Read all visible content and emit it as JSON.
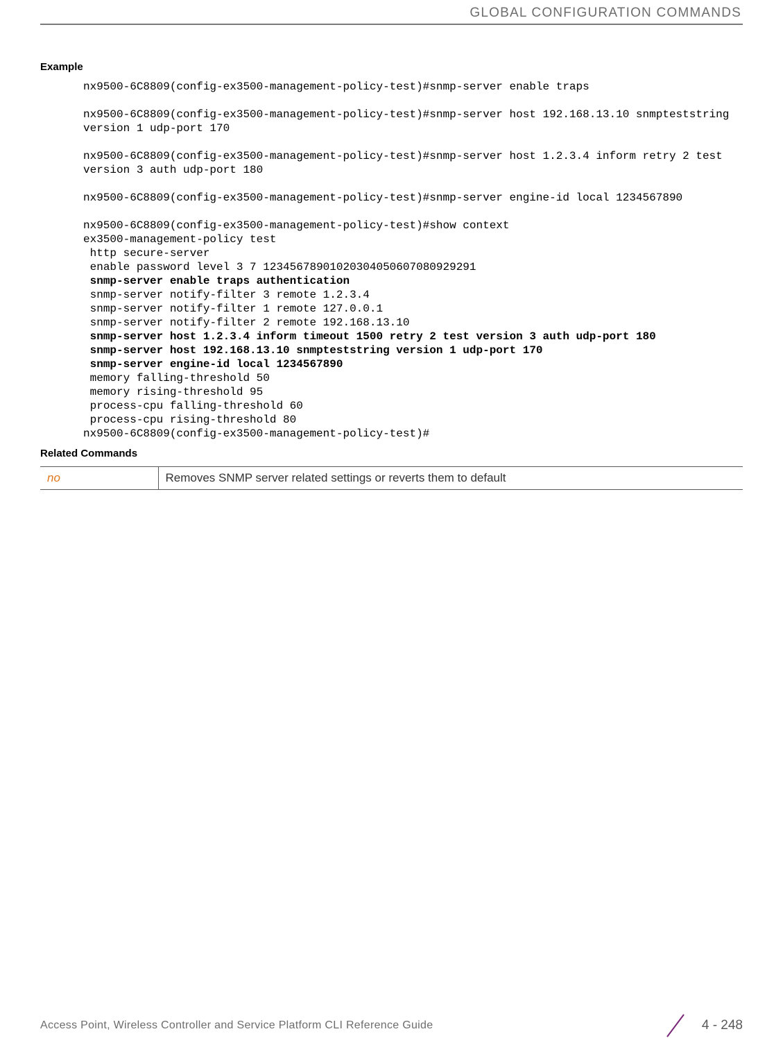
{
  "header": {
    "title": "GLOBAL CONFIGURATION COMMANDS"
  },
  "example": {
    "heading": "Example",
    "blocks": [
      {
        "text": "nx9500-6C8809(config-ex3500-management-policy-test)#snmp-server enable traps"
      },
      {
        "text": "nx9500-6C8809(config-ex3500-management-policy-test)#snmp-server host 192.168.13.10 snmpteststring version 1 udp-port 170"
      },
      {
        "text": "nx9500-6C8809(config-ex3500-management-policy-test)#snmp-server host 1.2.3.4 inform retry 2 test version 3 auth udp-port 180"
      },
      {
        "text": "nx9500-6C8809(config-ex3500-management-policy-test)#snmp-server engine-id local 1234567890"
      }
    ],
    "context": {
      "line0": "nx9500-6C8809(config-ex3500-management-policy-test)#show context",
      "line1": "ex3500-management-policy test",
      "line2": " http secure-server",
      "line3": " enable password level 3 7 12345678901020304050607080929291",
      "bold1": " snmp-server enable traps authentication",
      "line4": " snmp-server notify-filter 3 remote 1.2.3.4",
      "line5": " snmp-server notify-filter 1 remote 127.0.0.1",
      "line6": " snmp-server notify-filter 2 remote 192.168.13.10",
      "bold2a": " snmp-server host 1.2.3.4 inform timeout 1500 retry 2 test version 3 auth udp-port ",
      "bold2b": "180",
      "bold3": " snmp-server host 192.168.13.10 snmpteststring version 1 udp-port 170",
      "bold4": " snmp-server engine-id local 1234567890",
      "line7": " memory falling-threshold 50",
      "line8": " memory rising-threshold 95",
      "line9": " process-cpu falling-threshold 60",
      "line10": " process-cpu rising-threshold 80",
      "line11": "nx9500-6C8809(config-ex3500-management-policy-test)#"
    }
  },
  "related": {
    "heading": "Related Commands",
    "rows": [
      {
        "cmd": "no",
        "desc": "Removes SNMP server related settings or reverts them to default"
      }
    ]
  },
  "footer": {
    "left": "Access Point, Wireless Controller and Service Platform CLI Reference Guide",
    "page": "4 - 248"
  }
}
